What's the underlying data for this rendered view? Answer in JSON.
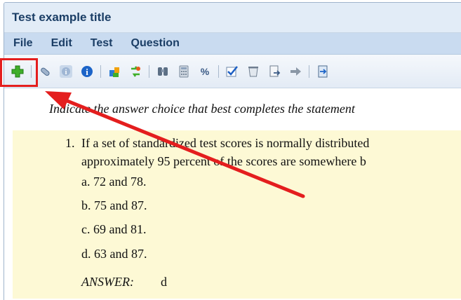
{
  "window": {
    "title": "Test example title"
  },
  "menu": {
    "items": [
      "File",
      "Edit",
      "Test",
      "Question"
    ]
  },
  "toolbar": {
    "groups": [
      [
        "add-icon"
      ],
      [
        "attach-icon",
        "info-disabled-icon",
        "info-icon"
      ],
      [
        "import-icon",
        "convert-icon"
      ],
      [
        "find-icon",
        "calculator-icon",
        "percent-icon"
      ],
      [
        "check-icon",
        "bin-icon",
        "export-icon",
        "arrow-right-icon"
      ],
      [
        "document-icon"
      ]
    ]
  },
  "content": {
    "instruction": "Indicate the answer choice that best completes the statement",
    "question": {
      "number": "1.",
      "line1": "If a set of standardized test scores is normally distributed",
      "line2": "approximately 95 percent of the scores are somewhere b",
      "choices": [
        "a. 72 and 78.",
        "b. 75 and 87.",
        "c. 69 and 81.",
        "d. 63 and 87."
      ],
      "answer_label": "ANSWER:",
      "answer_value": "d"
    }
  },
  "colors": {
    "annotation": "#e41e1e",
    "question_bg": "#fdf9d5",
    "menu_bg": "#c9dbf0",
    "title_bg": "#e2ecf7"
  }
}
